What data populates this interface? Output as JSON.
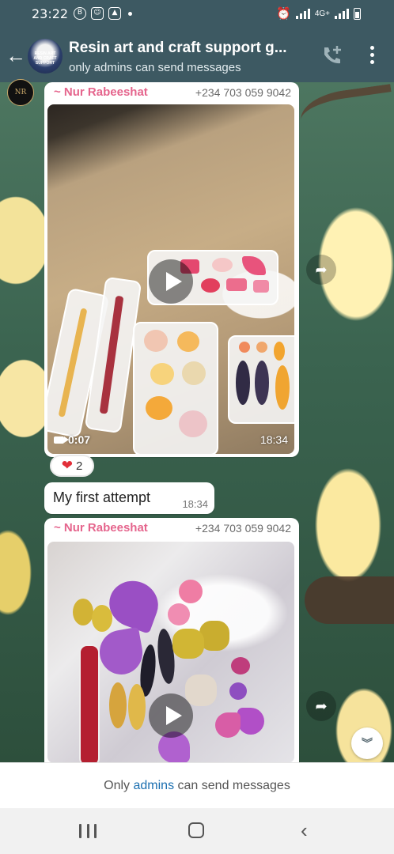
{
  "status_bar": {
    "time": "23:22",
    "network": "4G+"
  },
  "chat": {
    "title": "Resin art and craft support g...",
    "subtitle": "only admins can send messages",
    "avatar_text": "RESIN ART AND CRAFT SUPPORT"
  },
  "sender_avatar_text": "NR",
  "messages": [
    {
      "sender_name": "~ Nur Rabeeshat",
      "sender_phone": "+234 703 059 9042",
      "type": "video",
      "duration": "0:07",
      "time": "18:34"
    },
    {
      "type": "text",
      "text": "My first attempt",
      "time": "18:34"
    },
    {
      "sender_name": "~ Nur Rabeeshat",
      "sender_phone": "+234 703 059 9042",
      "type": "video"
    }
  ],
  "reaction": {
    "emoji": "❤",
    "count": "2"
  },
  "footer": {
    "prefix": "Only ",
    "highlight": "admins",
    "suffix": " can send messages"
  },
  "icons": {
    "back": "arrow-left",
    "call": "add-call",
    "menu": "more-vertical",
    "forward": "forward-arrow",
    "scroll": "double-chevron-down"
  },
  "colors": {
    "header_bg": "#3d5962",
    "sender_name": "#e5658d",
    "admin_link": "#1b6fb0"
  }
}
